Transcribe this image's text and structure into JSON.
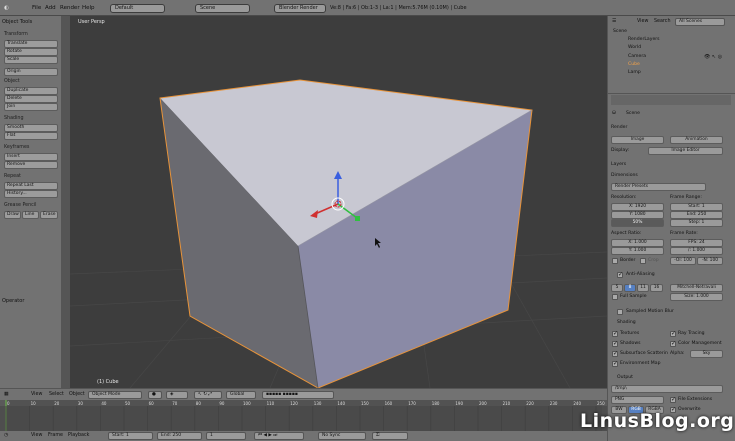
{
  "topbar": {
    "menus": [
      "File",
      "Add",
      "Render",
      "Help"
    ],
    "layout": "Default",
    "scene": "Scene",
    "engine": "Blender Render",
    "info": "Ve:8 | Fa:6 | Ob:1-3 | La:1 | Mem:5.76M (0.10M) | Cube"
  },
  "toolshelf": {
    "title": "Object Tools",
    "transform": {
      "header": "Transform",
      "items": [
        "Translate",
        "Rotate",
        "Scale"
      ],
      "origin": "Origin"
    },
    "object": {
      "header": "Object",
      "items": [
        "Duplicate",
        "Delete",
        "Join"
      ]
    },
    "shading": {
      "header": "Shading",
      "items": [
        "Smooth",
        "Flat"
      ]
    },
    "keyframes": {
      "header": "Keyframes",
      "items": [
        "Insert",
        "Remove"
      ]
    },
    "repeat": {
      "header": "Repeat",
      "items": [
        "Repeat Last",
        "History..."
      ]
    },
    "grease": {
      "header": "Grease Pencil",
      "items": [
        "Draw",
        "Line",
        "Erase"
      ]
    },
    "operator": "Operator"
  },
  "viewport": {
    "label": "User Persp",
    "object": "(1) Cube"
  },
  "vpheader": {
    "menus": [
      "View",
      "Select",
      "Object"
    ],
    "mode": "Object Mode",
    "orientation": "Global"
  },
  "timeline": {
    "ticks": [
      "0",
      "10",
      "20",
      "30",
      "40",
      "50",
      "60",
      "70",
      "80",
      "90",
      "100",
      "110",
      "120",
      "130",
      "140",
      "150",
      "160",
      "170",
      "180",
      "190",
      "200",
      "210",
      "220",
      "230",
      "240",
      "250"
    ],
    "menus": [
      "View",
      "Frame",
      "Playback"
    ],
    "start": "Start: 1",
    "end": "End: 250",
    "current": "1",
    "sync": "No Sync"
  },
  "outliner": {
    "menus": [
      "View",
      "Search"
    ],
    "filter": "All Scenes",
    "rows": [
      "Scene",
      "RenderLayers",
      "World",
      "Camera",
      "Cube",
      "Lamp"
    ]
  },
  "properties": {
    "scene_label": "Scene",
    "render": {
      "header": "Render",
      "image": "Image",
      "animation": "Animation",
      "display_label": "Display:",
      "display": "Image Editor"
    },
    "layers": "Layers",
    "dimensions": {
      "header": "Dimensions",
      "presets": "Render Presets",
      "resolution": "Resolution:",
      "x": "X: 1920",
      "y": "Y: 1080",
      "pct": "50%",
      "frame_range": "Frame Range:",
      "start": "Start: 1",
      "end": "End: 250",
      "step": "Step: 1",
      "aspect": "Aspect Ratio:",
      "ax": "X: 1.000",
      "ay": "Y: 1.000",
      "frame_rate": "Frame Rate:",
      "fps": "FPS: 24",
      "fpsb": "/: 1.000",
      "border": "Border",
      "crop": "Crop",
      "old": "-Ol: 100",
      "new": "-N: 100"
    },
    "aa": {
      "header": "Anti-Aliasing",
      "samples": [
        "5",
        "8",
        "11",
        "16"
      ],
      "filter": "Mitchell-Netravali",
      "full": "Full Sample",
      "size": "Size: 1.000"
    },
    "motion": "Sampled Motion Blur",
    "shading": {
      "header": "Shading",
      "textures": "Textures",
      "shadows": "Shadows",
      "sss": "Subsurface Scatterin",
      "env": "Environment Map",
      "raytracing": "Ray Tracing",
      "color_mgmt": "Color Management",
      "alpha_label": "Alpha:",
      "alpha": "Sky"
    },
    "output": {
      "header": "Output",
      "path": "/tmp\\",
      "format": "PNG",
      "file_ext": "File Extensions",
      "overwrite": "Overwrite",
      "channels": [
        "BW",
        "RGB",
        "RGBA"
      ]
    }
  },
  "watermark": "LinusBlog.org"
}
